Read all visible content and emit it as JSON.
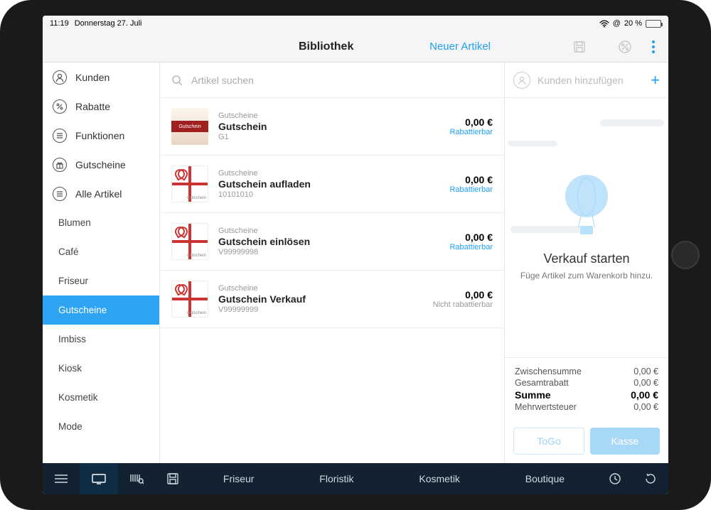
{
  "status": {
    "time": "11:19",
    "date": "Donnerstag 27. Juli",
    "battery": "20 %"
  },
  "header": {
    "title": "Bibliothek",
    "new_article": "Neuer Artikel"
  },
  "sidebar": {
    "top": [
      {
        "label": "Kunden",
        "glyph": "person"
      },
      {
        "label": "Rabatte",
        "glyph": "percent"
      },
      {
        "label": "Funktionen",
        "glyph": "list"
      },
      {
        "label": "Gutscheine",
        "glyph": "gift"
      },
      {
        "label": "Alle Artikel",
        "glyph": "list"
      }
    ],
    "cats": [
      "Blumen",
      "Café",
      "Friseur",
      "Gutscheine",
      "Imbiss",
      "Kiosk",
      "Kosmetik",
      "Mode"
    ],
    "selected_cat": "Gutscheine"
  },
  "search": {
    "placeholder": "Artikel suchen"
  },
  "items": [
    {
      "cat": "Gutscheine",
      "name": "Gutschein",
      "code": "G1",
      "price": "0,00 €",
      "disc": "Rabattierbar",
      "discOk": true,
      "thumb": "g"
    },
    {
      "cat": "Gutscheine",
      "name": "Gutschein aufladen",
      "code": "10101010",
      "price": "0,00 €",
      "disc": "Rabattierbar",
      "discOk": true,
      "thumb": "r"
    },
    {
      "cat": "Gutscheine",
      "name": "Gutschein einlösen",
      "code": "V99999998",
      "price": "0,00 €",
      "disc": "Rabattierbar",
      "discOk": true,
      "thumb": "r"
    },
    {
      "cat": "Gutscheine",
      "name": "Gutschein Verkauf",
      "code": "V99999999",
      "price": "0,00 €",
      "disc": "Nicht rabattierbar",
      "discOk": false,
      "thumb": "r"
    }
  ],
  "cart": {
    "add_customer": "Kunden hinzufügen",
    "empty_title": "Verkauf starten",
    "empty_sub": "Füge Artikel zum Warenkorb hinzu.",
    "totals": {
      "subtotal_l": "Zwischensumme",
      "subtotal_v": "0,00 €",
      "discount_l": "Gesamtrabatt",
      "discount_v": "0,00 €",
      "sum_l": "Summe",
      "sum_v": "0,00 €",
      "vat_l": "Mehrwertsteuer",
      "vat_v": "0,00 €"
    },
    "togo": "ToGo",
    "kasse": "Kasse"
  },
  "bottom": {
    "tabs": [
      "Friseur",
      "Floristik",
      "Kosmetik",
      "Boutique"
    ]
  }
}
